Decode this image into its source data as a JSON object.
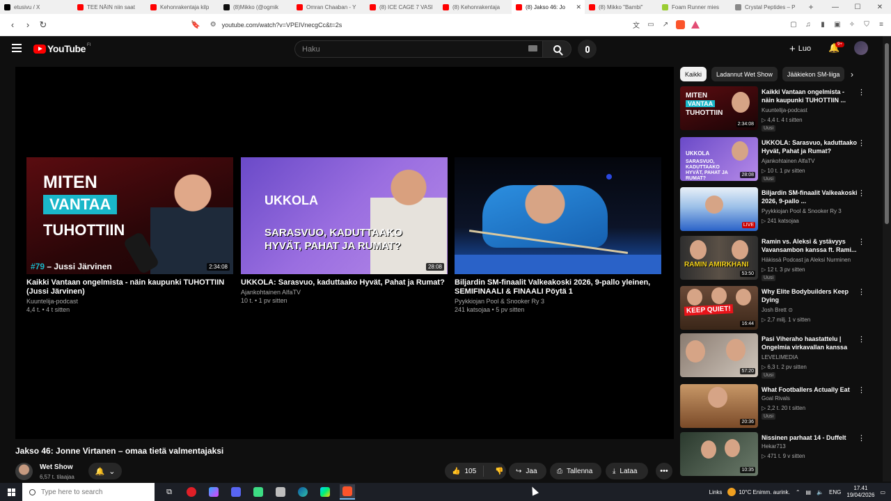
{
  "browser": {
    "tabs": [
      {
        "label": "etusivu / X",
        "icon": "x-logo-icon",
        "color": "#000000",
        "active": false
      },
      {
        "label": "TEE NÄIN niin saat",
        "icon": "youtube-icon",
        "color": "#ff0000",
        "active": false
      },
      {
        "label": "Kehonrakentaja kilp",
        "icon": "youtube-icon",
        "color": "#ff0000",
        "active": false
      },
      {
        "label": "(8)Mikko (@ogmik",
        "icon": "tiktok-icon",
        "color": "#111111",
        "active": false
      },
      {
        "label": "Omran Chaaban - Y",
        "icon": "youtube-icon",
        "color": "#ff0000",
        "active": false
      },
      {
        "label": "(8) ICE CAGE 7 VASI",
        "icon": "youtube-icon",
        "color": "#ff0000",
        "active": false
      },
      {
        "label": "(8) Kehonrakentaja",
        "icon": "youtube-icon",
        "color": "#ff0000",
        "active": false
      },
      {
        "label": "(8) Jakso 46: Jo",
        "icon": "youtube-icon",
        "color": "#ff0000",
        "active": true
      },
      {
        "label": "(8) Mikko \"Bambi\"",
        "icon": "youtube-icon",
        "color": "#ff0000",
        "active": false
      },
      {
        "label": "Foam Runner mies",
        "icon": "shop-icon",
        "color": "#9acd32",
        "active": false
      },
      {
        "label": "Crystal Peptides – P",
        "icon": "globe-icon",
        "color": "#888888",
        "active": false
      }
    ],
    "url": "youtube.com/watch?v=VPEIVnecgCc&t=2s"
  },
  "header": {
    "logo": "YouTube",
    "country": "FI",
    "search_placeholder": "Haku",
    "create_label": "Luo",
    "notifications": "9+"
  },
  "endscreen": [
    {
      "title": "Kaikki Vantaan ongelmista - näin kaupunki TUHOTTIIN (Jussi Järvinen)",
      "channel": "Kuuntelija-podcast",
      "meta": "4,4 t. • 4 t sitten",
      "duration": "2:34:08",
      "thumb_line1": "MITEN",
      "thumb_line2": "VANTAA",
      "thumb_line3": "TUHOTTIIN",
      "thumb_ep": "#79",
      "thumb_name": " – Jussi Järvinen"
    },
    {
      "title": "UKKOLA: Sarasvuo, kaduttaako Hyvät, Pahat ja Rumat?",
      "channel": "Ajankohtainen AlfaTV",
      "meta": "10 t. • 1 pv sitten",
      "duration": "28:08",
      "thumb_line1": "UKKOLA",
      "thumb_line2": "SARASVUO, KADUTTAAKO HYVÄT, PAHAT JA RUMAT?"
    },
    {
      "title": "Biljardin SM-finaalit Valkeakoski 2026, 9-pallo yleinen, SEMIFINAALI & FINAALI Pöytä 1",
      "channel": "Pyykkiojan Pool & Snooker Ry 3",
      "meta": "241 katsojaa • 5 pv sitten"
    }
  ],
  "video": {
    "title": "Jakso 46: Jonne Virtanen – omaa tietä valmentajaksi",
    "channel": "Wet Show",
    "subscribers": "6,57 t. tilaajaa",
    "likes": "105",
    "share_label": "Jaa",
    "save_label": "Tallenna",
    "download_label": "Lataa"
  },
  "chips": [
    "Kaikki",
    "Ladannut Wet Show",
    "Jääkiekon SM-liiga"
  ],
  "related": [
    {
      "title": "Kaikki Vantaan ongelmista - näin kaupunki TUHOTTIIN ...",
      "channel": "Kuuntelija-podcast",
      "meta": "▷ 4,4 t.   4 t sitten",
      "badge": "Uusi",
      "duration": "2:34:08",
      "thumb": "t-a"
    },
    {
      "title": "UKKOLA: Sarasvuo, kaduttaako Hyvät, Pahat ja Rumat?",
      "channel": "Ajankohtainen AlfaTV",
      "meta": "▷ 10 t.   1 pv sitten",
      "badge": "Uusi",
      "duration": "28:08",
      "thumb": "t-b"
    },
    {
      "title": "Biljardin SM-finaalit Valkeakoski 2026, 9-pallo ...",
      "channel": "Pyykkiojan Pool & Snooker Ry 3",
      "meta": "▷ 241 katsojaa",
      "badge": "",
      "duration": "LIVE",
      "thumb": "t-c"
    },
    {
      "title": "Ramin vs. Aleksi & ystävyys Vavansambon kanssa ft. Rami...",
      "channel": "Häkissä Podcast ja Aleksi Nurminen",
      "meta": "▷ 12 t.   3 pv sitten",
      "badge": "Uusi",
      "duration": "53:50",
      "thumb": "t-d"
    },
    {
      "title": "Why Elite Bodybuilders Keep Dying",
      "channel": "Josh Brett ⊙",
      "meta": "▷ 2,7 milj.   1 v sitten",
      "badge": "",
      "duration": "16:44",
      "thumb": "t-e"
    },
    {
      "title": "Pasi Viheraho haastattelu | Ongelmia virkavallan kanssa",
      "channel": "LEVELIMEDIA",
      "meta": "▷ 6,3 t.   2 pv sitten",
      "badge": "Uusi",
      "duration": "57:20",
      "thumb": "t-f"
    },
    {
      "title": "What Footballers Actually Eat",
      "channel": "Goal Rivals",
      "meta": "▷ 2,2 t.   20 t sitten",
      "badge": "Uusi",
      "duration": "20:36",
      "thumb": "t-g"
    },
    {
      "title": "Nissinen parhaat 14 - Duffelt",
      "channel": "Hekar713",
      "meta": "▷ 471 t.   9 v sitten",
      "badge": "",
      "duration": "10:35",
      "thumb": "t-h"
    }
  ],
  "related_thumb_text": {
    "a1": "MITEN",
    "a2": "VANTAA",
    "a3": "TUHOTTIIN",
    "b1": "UKKOLA",
    "b2": "SARASVUO, KADUTTAAKO HYVÄT, PAHAT JA RUMAT?",
    "d1": "RAMIN AMIRKHANI",
    "e1": "KEEP QUIET!"
  },
  "taskbar": {
    "search_placeholder": "Type here to search",
    "links_label": "Links",
    "weather": "10°C  Enimm. aurink.",
    "language": "ENG",
    "time": "17.41",
    "date": "19/04/2026"
  }
}
